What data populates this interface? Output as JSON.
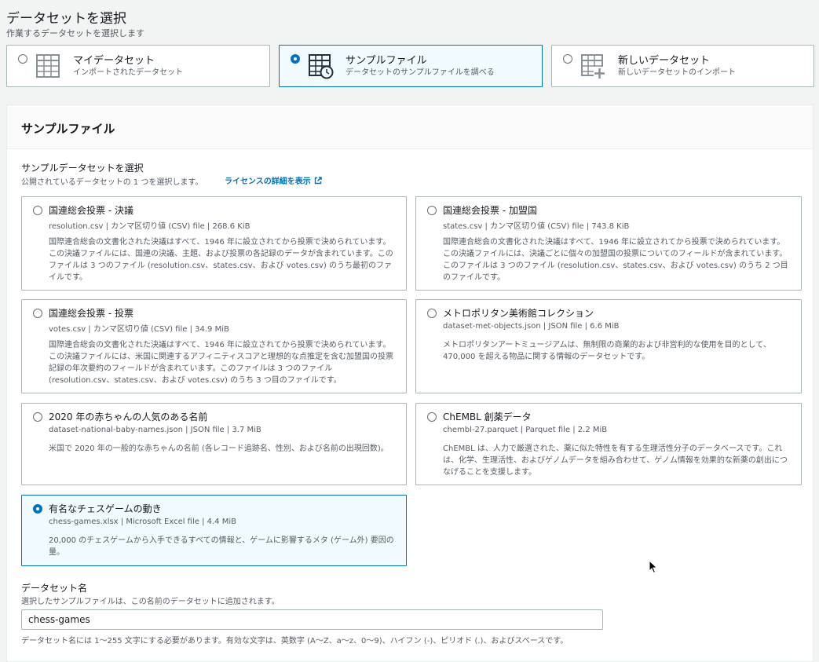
{
  "header": {
    "title": "データセットを選択",
    "description": "作業するデータセットを選択します"
  },
  "sources": [
    {
      "title": "マイデータセット",
      "description": "インポートされたデータセット",
      "icon": "table-icon",
      "selected": false
    },
    {
      "title": "サンプルファイル",
      "description": "データセットのサンプルファイルを調べる",
      "icon": "table-clock-icon",
      "selected": true
    },
    {
      "title": "新しいデータセット",
      "description": "新しいデータセットのインポート",
      "icon": "table-plus-icon",
      "selected": false
    }
  ],
  "panel": {
    "title": "サンプルファイル",
    "section_label": "サンプルデータセットを選択",
    "section_desc": "公開されているデータセットの 1 つを選択します。",
    "license_link": "ライセンスの詳細を表示"
  },
  "samples": [
    {
      "title": "国連総会投票 - 決議",
      "meta": "resolution.csv | カンマ区切り値 (CSV) file | 268.6 KiB",
      "description": "国際連合総会の文書化された決議はすべて、1946 年に設立されてから投票で決められています。この決議ファイルには、国連の決議、主題、および投票の各記録のデータが含まれています。このファイルは 3 つのファイル (resolution.csv、states.csv、および votes.csv) のうち最初のファイルです。",
      "selected": false
    },
    {
      "title": "国連総会投票 - 加盟国",
      "meta": "states.csv | カンマ区切り値 (CSV) file | 743.8 KiB",
      "description": "国際連合総会の文書化された決議はすべて、1946 年に設立されてから投票で決められています。この決議ファイルには、決議ごとに個々の加盟国の投票についてのフィールドが含まれています。このファイルは 3 つのファイル (resolution.csv、states.csv、および votes.csv) のうち 2 つ目のファイルです。",
      "selected": false
    },
    {
      "title": "国連総会投票 - 投票",
      "meta": "votes.csv | カンマ区切り値 (CSV) file | 34.9 MiB",
      "description": "国際連合総会の文書化された決議はすべて、1946 年に設立されてから投票で決められています。この決議ファイルには、米国に関連するアフィニティスコアと理想的な点推定を含む加盟国の投票記録の年次要約のフィールドが含まれています。このファイルは 3 つのファイル (resolution.csv、states.csv、および votes.csv) のうち 3 つ目のファイルです。",
      "selected": false
    },
    {
      "title": "メトロポリタン美術館コレクション",
      "meta": "dataset-met-objects.json | JSON file | 6.6 MiB",
      "description": "メトロポリタンアートミュージアムは、無制限の商業的および非営利的な使用を目的として、470,000 を超える物品に関する情報のデータセットです。",
      "selected": false
    },
    {
      "title": "2020 年の赤ちゃんの人気のある名前",
      "meta": "dataset-national-baby-names.json | JSON file | 3.7 MiB",
      "description": "米国で 2020 年の一般的な赤ちゃんの名前 (各レコード追跡名、性別、および名前の出現回数)。",
      "selected": false
    },
    {
      "title": "ChEMBL 創薬データ",
      "meta": "chembl-27.parquet | Parquet file | 2.2 MiB",
      "description": "ChEMBL は、人力で厳選された、薬に似た特性を有する生理活性分子のデータベースです。これは、化学、生理活性、およびゲノムデータを組み合わせて、ゲノム情報を効果的な新薬の創出につなげることを支援します。",
      "selected": false
    },
    {
      "title": "有名なチェスゲームの動き",
      "meta": "chess-games.xlsx | Microsoft Excel file | 4.4 MiB",
      "description": "20,000 のチェスゲームから入手できるすべての情報と、ゲームに影響するメタ (ゲーム外) 要因の量。",
      "selected": true
    }
  ],
  "dataset_name": {
    "label": "データセット名",
    "description": "選択したサンプルファイルは、この名前のデータセットに追加されます。",
    "value": "chess-games",
    "hint": "データセット名には 1〜255 文字にする必要があります。有効な文字は、英数字 (A〜Z、a〜z、0〜9)、ハイフン (-)、ピリオド (.)、およびスペースです。"
  },
  "colors": {
    "accent": "#0073bb",
    "border": "#aab7b8",
    "muted": "#545b64"
  }
}
